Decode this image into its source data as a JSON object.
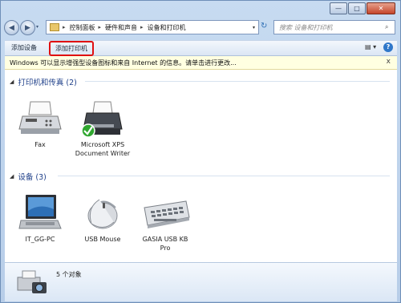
{
  "window": {
    "minimize": "—",
    "maximize": "□",
    "close": "✕"
  },
  "nav": {
    "back": "◀",
    "forward": "▶",
    "dropdown": "▾"
  },
  "address": {
    "segments": [
      "控制面板",
      "硬件和声音",
      "设备和打印机"
    ],
    "separator": "▸",
    "dropdown": "▾",
    "refresh": "↻"
  },
  "search": {
    "placeholder": "搜索 设备和打印机",
    "icon": "⌕"
  },
  "commands": {
    "add_device": "添加设备",
    "add_printer": "添加打印机",
    "view": "▤ ▾",
    "help": "?"
  },
  "info_bar": {
    "text": "Windows 可以显示增强型设备图标和来自 Internet 的信息。请单击进行更改...",
    "close": "x"
  },
  "groups": [
    {
      "label": "打印机和传真 (2)",
      "toggle": "◢",
      "items": [
        {
          "name": "Fax",
          "icon": "fax-icon"
        },
        {
          "name": "Microsoft XPS Document Writer",
          "icon": "printer-default-icon"
        }
      ]
    },
    {
      "label": "设备 (3)",
      "toggle": "◢",
      "items": [
        {
          "name": "IT_GG-PC",
          "icon": "laptop-icon"
        },
        {
          "name": "USB Mouse",
          "icon": "mouse-icon"
        },
        {
          "name": "GASIA USB KB Pro",
          "icon": "keyboard-icon"
        }
      ]
    }
  ],
  "details": {
    "count": "5 个对象",
    "icon": "camera-printer-icon"
  },
  "colors": {
    "highlight_border": "#e01010",
    "group_header": "#1e3f89",
    "info_bar_bg": "#ffffe1"
  }
}
